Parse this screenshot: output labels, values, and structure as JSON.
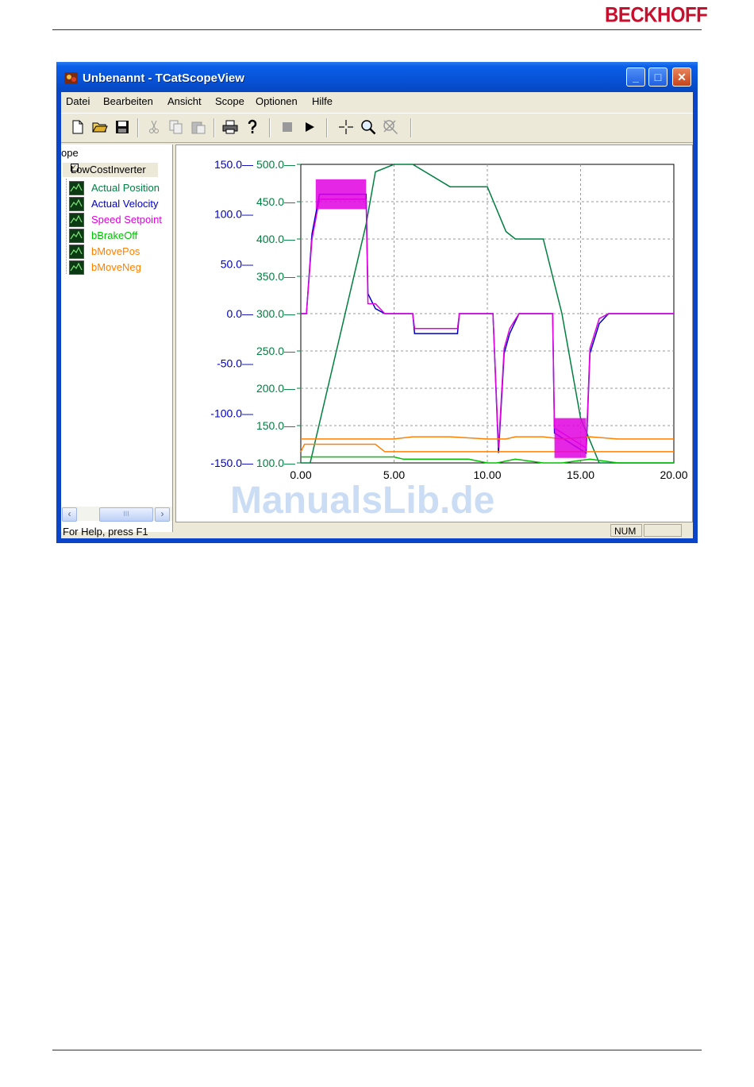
{
  "brand": "BECKHOFF",
  "window": {
    "title": "Unbenannt - TCatScopeView",
    "controls": {
      "minimize": "_",
      "maximize": "□",
      "close": "✕"
    }
  },
  "menu": [
    "Datei",
    "Bearbeiten",
    "Ansicht",
    "Scope",
    "Optionen",
    "Hilfe"
  ],
  "toolbar": [
    "new-file-icon",
    "open-folder-icon",
    "save-icon",
    "cut-icon",
    "copy-icon",
    "paste-icon",
    "print-icon",
    "help-icon",
    "stop-icon",
    "play-icon",
    "cursor-crosshair-icon",
    "zoom-icon",
    "zoom-reset-icon"
  ],
  "tree": {
    "root": "ope",
    "node": "LowCostInverter",
    "channels": [
      {
        "label": "Actual Position",
        "color": "#008040"
      },
      {
        "label": "Actual Velocity",
        "color": "#0000c0"
      },
      {
        "label": "Speed Setpoint",
        "color": "#e000e0"
      },
      {
        "label": "bBrakeOff",
        "color": "#00c000"
      },
      {
        "label": "bMovePos",
        "color": "#ff8000"
      },
      {
        "label": "bMoveNeg",
        "color": "#ff8000"
      }
    ]
  },
  "statusbar": {
    "text": "For Help, press F1",
    "num": "NUM"
  },
  "watermark": "ManualsLib.de",
  "chart_data": {
    "type": "line",
    "x_ticks": [
      "0.00",
      "5.00",
      "10.00",
      "15.00",
      "20.00"
    ],
    "xlim": [
      0,
      20
    ],
    "y_axes": [
      {
        "ticks": [
          "150.0",
          "100.0",
          "50.0",
          "0.0",
          "-50.0",
          "-100.0",
          "-150.0"
        ],
        "ylim": [
          -150,
          150
        ],
        "color": "#0000c0"
      },
      {
        "ticks": [
          "500.0",
          "450.0",
          "400.0",
          "350.0",
          "300.0",
          "250.0",
          "200.0",
          "150.0",
          "100.0"
        ],
        "ylim": [
          100,
          500
        ],
        "color": "#008040"
      }
    ],
    "grid": true,
    "series": [
      {
        "name": "Actual Position",
        "color": "#008040",
        "axis": 1,
        "x": [
          0,
          0.5,
          3.5,
          4.0,
          5.0,
          6.0,
          8.0,
          10.0,
          11.0,
          11.5,
          13.0,
          14.0,
          15.0,
          16.0,
          17.0,
          20.0
        ],
        "y": [
          100,
          100,
          420,
          490,
          500,
          500,
          470,
          470,
          410,
          400,
          400,
          300,
          160,
          100,
          100,
          100
        ]
      },
      {
        "name": "Actual Velocity",
        "color": "#0000c0",
        "axis": 0,
        "x": [
          0,
          0.3,
          0.6,
          1.0,
          3.5,
          3.6,
          4.0,
          4.5,
          5.0,
          6.0,
          6.1,
          8.4,
          8.5,
          10.3,
          10.6,
          10.9,
          11.2,
          11.7,
          13.5,
          13.6,
          15.3,
          15.5,
          16.0,
          16.5,
          20.0
        ],
        "y": [
          0,
          0,
          80,
          120,
          120,
          20,
          5,
          0,
          0,
          0,
          -20,
          -20,
          0,
          0,
          -140,
          -40,
          -20,
          0,
          0,
          -120,
          -140,
          -40,
          -10,
          0,
          0
        ]
      },
      {
        "name": "Speed Setpoint",
        "color": "#e000e0",
        "axis": 0,
        "x": [
          0,
          0.3,
          0.6,
          1.0,
          3.5,
          3.6,
          4.0,
          4.5,
          5.0,
          6.0,
          6.1,
          8.4,
          8.5,
          10.3,
          10.6,
          10.9,
          11.2,
          11.7,
          13.5,
          13.6,
          15.3,
          15.5,
          16.0,
          16.5,
          20.0
        ],
        "y": [
          0,
          0,
          75,
          115,
          115,
          10,
          10,
          0,
          0,
          0,
          -15,
          -15,
          0,
          0,
          -135,
          -35,
          -15,
          0,
          0,
          -115,
          -135,
          -35,
          -5,
          0,
          0
        ]
      },
      {
        "name": "bBrakeOff",
        "color": "#00c000",
        "axis": 1,
        "x": [
          0,
          0.0,
          0.5,
          5.0,
          5.5,
          9.0,
          10.0,
          10.5,
          11.5,
          13.0,
          14.0,
          15.5,
          17.0,
          20.0
        ],
        "y": [
          108,
          108,
          108,
          108,
          105,
          105,
          100,
          100,
          105,
          100,
          100,
          105,
          100,
          100
        ]
      },
      {
        "name": "bMovePos",
        "color": "#ff8000",
        "axis": 1,
        "x": [
          0,
          0.0,
          0.5,
          5.0,
          6.0,
          8.0,
          10.0,
          11.0,
          11.5,
          13.0,
          14.0,
          15.5,
          17.0,
          20.0
        ],
        "y": [
          132,
          132,
          132,
          132,
          135,
          135,
          132,
          132,
          135,
          135,
          132,
          135,
          132,
          132
        ]
      },
      {
        "name": "bMoveNeg",
        "color": "#ff8000",
        "axis": 1,
        "x": [
          0,
          0.2,
          0.5,
          4.0,
          4.5,
          20.0
        ],
        "y": [
          115,
          125,
          125,
          125,
          115,
          115
        ]
      }
    ]
  }
}
